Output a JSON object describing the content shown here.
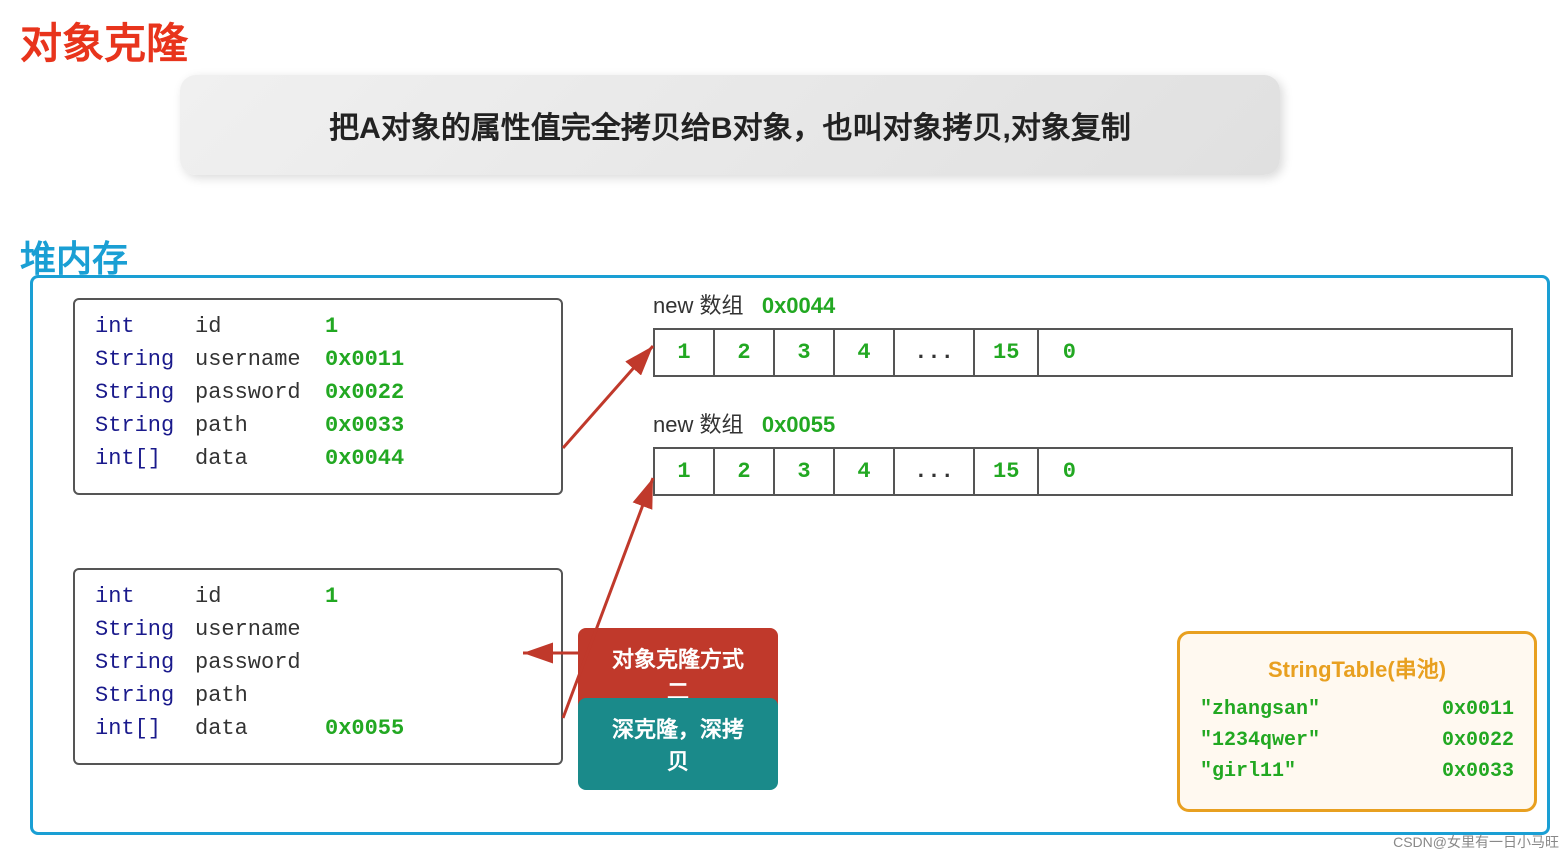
{
  "page": {
    "title": "对象克隆",
    "description": "把A对象的属性值完全拷贝给B对象，也叫对象拷贝,对象复制",
    "heap_label": "堆内存",
    "watermark": "CSDN@女里有一日小马旺"
  },
  "obj_a": {
    "rows": [
      {
        "type": "int",
        "field": "id",
        "value": "1",
        "value_color": "green"
      },
      {
        "type": "String",
        "field": "username",
        "value": "0x0011",
        "value_color": "green"
      },
      {
        "type": "String",
        "field": "password",
        "value": "0x0022",
        "value_color": "green"
      },
      {
        "type": "String",
        "field": "path",
        "value": "0x0033",
        "value_color": "green"
      },
      {
        "type": "int[]",
        "field": "data",
        "value": "0x0044",
        "value_color": "green"
      }
    ]
  },
  "obj_b": {
    "rows": [
      {
        "type": "int",
        "field": "id",
        "value": "1",
        "value_color": "green"
      },
      {
        "type": "String",
        "field": "username",
        "value": "",
        "value_color": "none"
      },
      {
        "type": "String",
        "field": "password",
        "value": "",
        "value_color": "none"
      },
      {
        "type": "String",
        "field": "path",
        "value": "",
        "value_color": "none"
      },
      {
        "type": "int[]",
        "field": "data",
        "value": "0x0055",
        "value_color": "green"
      }
    ]
  },
  "array1": {
    "label_kw": "new 数组",
    "label_addr": "0x0044",
    "cells": [
      "1",
      "2",
      "3",
      "4",
      "...",
      "15",
      "0"
    ]
  },
  "array2": {
    "label_kw": "new 数组",
    "label_addr": "0x0055",
    "cells": [
      "1",
      "2",
      "3",
      "4",
      "...",
      "15",
      "0"
    ]
  },
  "clone_buttons": {
    "btn1": "对象克隆方式二",
    "btn2": "深克隆，深拷贝"
  },
  "string_table": {
    "title": "StringTable(串池)",
    "entries": [
      {
        "key": "\"zhangsan\"",
        "value": "0x0011"
      },
      {
        "key": "\"1234qwer\"",
        "value": "0x0022"
      },
      {
        "key": "\"girl11\"",
        "value": "0x0033"
      }
    ]
  }
}
